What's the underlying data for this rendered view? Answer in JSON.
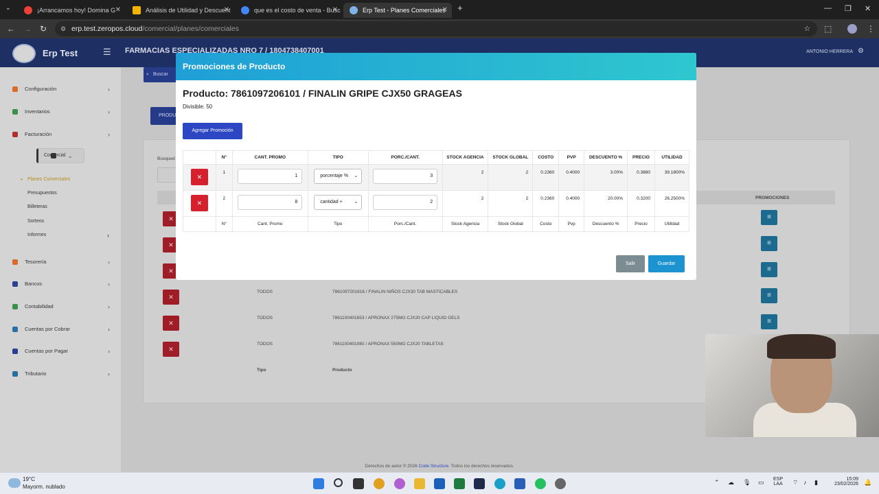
{
  "browser": {
    "tabs": [
      {
        "label": "¡Arrancamos hoy! Domina G",
        "color": "#ea4335"
      },
      {
        "label": "Análisis de Utilidad y Descuent",
        "color": "#f4b400"
      },
      {
        "label": "que es el costo de venta - Busc",
        "color": "#4285f4"
      },
      {
        "label": "Erp Test - Planes Comerciales",
        "color": "#7fb3e8"
      }
    ],
    "url_host": "erp.test.zeropos.cloud",
    "url_path": "/comercial/planes/comerciales"
  },
  "app": {
    "brand": "Erp Test",
    "company": "FARMACIAS ESPECIALIZADAS NRO 7 / 1804738407001",
    "user": "ANTONIO HERRERA",
    "search_label": "Buscar",
    "product_btn": "PRODU",
    "busqueda_label": "Busqued",
    "promos_header": "PROMOCIONES",
    "footer_prefix": "Derechos de autor © 2026",
    "footer_link": "Code Structure",
    "footer_suffix": ". Todos los derechos reservados."
  },
  "sidebar": {
    "items": [
      {
        "label": "Configuración",
        "color": "#d96b2b"
      },
      {
        "label": "Inventarios",
        "color": "#3a8f4a"
      },
      {
        "label": "Facturación",
        "color": "#b03030"
      },
      {
        "label": "Comercial",
        "color": "#333333"
      },
      {
        "label": "Tesorería",
        "color": "#d96b2b"
      },
      {
        "label": "Bancos",
        "color": "#2a3f8f"
      },
      {
        "label": "Contabilidad",
        "color": "#3a8f4a"
      },
      {
        "label": "Cuentas por Cobrar",
        "color": "#2a6f9f"
      },
      {
        "label": "Cuentas por Pagar",
        "color": "#2a3f8f"
      },
      {
        "label": "Tributario",
        "color": "#2a6f9f"
      }
    ],
    "subitems": [
      "Planes Comerciales",
      "Presupuestos",
      "Billeteras",
      "Sorteos",
      "Informes"
    ]
  },
  "background_table": {
    "rows": [
      {
        "tipo": "TODOS",
        "producto": "7861097201816 / FINALIN NIÑOS CJX30 TAB MASTICABLES"
      },
      {
        "tipo": "TODOS",
        "producto": "7861100401653 / APRONAX 275MG CJX20 CAP LIQUID GELS"
      },
      {
        "tipo": "TODOS",
        "producto": "7861100401080 / APRONAX 550MG CJX20 TABLETAS"
      }
    ],
    "footer_tipo": "Tipo",
    "footer_producto": "Producto"
  },
  "modal": {
    "title": "Promociones de Producto",
    "product": "Producto: 7861097206101 / FINALIN GRIPE CJX50 GRAGEAS",
    "divisible": "Divisible: 50",
    "add_button": "Agregar Promoción",
    "headers": [
      "",
      "N°",
      "CANT. PROMO",
      "TIPO",
      "PORC./CANT.",
      "STOCK AGENCIA",
      "STOCK GLOBAL",
      "COSTO",
      "PVP",
      "DESCUENTO %",
      "PRECIO",
      "UTILIDAD"
    ],
    "footers": [
      "",
      "N°",
      "Cant. Promo",
      "Tipo",
      "Porc./Cant.",
      "Stock Agencia",
      "Stock Global",
      "Costo",
      "Pvp",
      "Descuento %",
      "Precio",
      "Utilidad"
    ],
    "rows": [
      {
        "n": "1",
        "cant": "1",
        "tipo": "porcentaje %",
        "porc": "3",
        "stock_agencia": "2",
        "stock_global": "2",
        "costo": "0.2360",
        "pvp": "0.4000",
        "descuento": "3.00%",
        "precio": "0.3880",
        "utilidad": "39.1800%"
      },
      {
        "n": "2",
        "cant": "8",
        "tipo": "cantidad +",
        "porc": "2",
        "stock_agencia": "2",
        "stock_global": "2",
        "costo": "0.2360",
        "pvp": "0.4000",
        "descuento": "20.00%",
        "precio": "0.3200",
        "utilidad": "26.2500%"
      }
    ],
    "salir": "Salir",
    "guardar": "Guardar"
  },
  "taskbar": {
    "temp": "19°C",
    "weather": "Mayorm. nublado",
    "lang1": "ESP",
    "lang2": "LAA",
    "time": "15:09",
    "date": "23/02/2026"
  }
}
